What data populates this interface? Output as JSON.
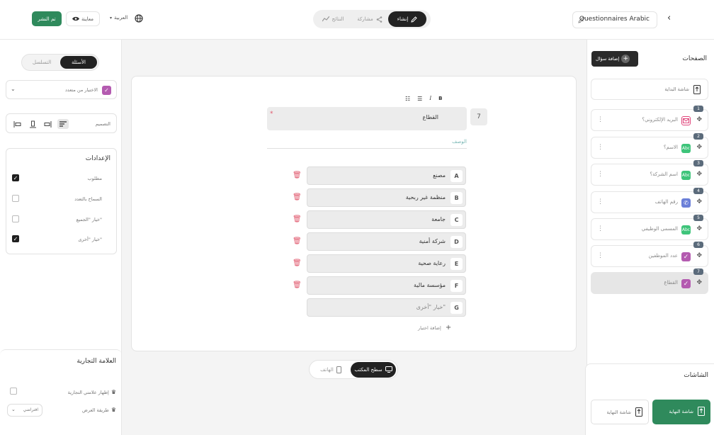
{
  "topbar": {
    "title": "Questionnaires Arabic",
    "tabs": [
      {
        "label": "إنشاء",
        "active": true
      },
      {
        "label": "مشاركة",
        "active": false
      },
      {
        "label": "النتائج",
        "active": false
      }
    ],
    "language": "العربية",
    "preview_label": "معاينة",
    "publish_label": "تم النشر"
  },
  "left_panel": {
    "tabs": [
      {
        "label": "الأسئلة",
        "active": true
      },
      {
        "label": "التسلسل",
        "active": false
      }
    ],
    "question_type": "الاختيار من متعدد",
    "design_label": "التصميم",
    "settings": {
      "title": "الإعدادات",
      "items": [
        {
          "label": "مطلوب",
          "checked": true
        },
        {
          "label": "السماح بالتعدد",
          "checked": false
        },
        {
          "label": "خيار \"الجميع\"",
          "checked": false
        },
        {
          "label": "خيار \"أخرى\"",
          "checked": true
        }
      ]
    },
    "branding": {
      "title": "العلامة التجارية",
      "show_brand_label": "إظهار علامتي التجارية",
      "show_brand_checked": false,
      "display_mode_label": "طريقة العرض",
      "display_mode_value": "افتراضي"
    }
  },
  "editor": {
    "question_number": "7",
    "question_title": "القطاع",
    "required_mark": "*",
    "description_placeholder": "الوصف",
    "toolbar": [
      "B",
      "I",
      "list",
      "numbered-list"
    ],
    "options": [
      {
        "letter": "A",
        "text": "مصنع"
      },
      {
        "letter": "B",
        "text": "منظمة غير ربحية"
      },
      {
        "letter": "C",
        "text": "جامعة"
      },
      {
        "letter": "D",
        "text": "شركة أمنية"
      },
      {
        "letter": "E",
        "text": "رعاية صحية"
      },
      {
        "letter": "F",
        "text": "مؤسسة مالية"
      },
      {
        "letter": "G",
        "text": "خيار \"أخرى\""
      }
    ],
    "add_option_label": "إضافة اختيار"
  },
  "view_toggle": {
    "desktop_label": "سطح المكتب",
    "mobile_label": "الهاتف"
  },
  "right_panel": {
    "pages_title": "الصفحات",
    "add_question_label": "إضافة سؤال",
    "start_page_label": "شاشة البداية",
    "questions": [
      {
        "num": "1",
        "label": "البريد الإلكتروني؟",
        "icon": "envelope-icon",
        "color": "#e0447a"
      },
      {
        "num": "2",
        "label": "الاسم؟",
        "icon": "text-abc-icon",
        "color": "#3ec47a"
      },
      {
        "num": "3",
        "label": "اسم الشركة؟",
        "icon": "text-abc-icon",
        "color": "#3ec47a"
      },
      {
        "num": "4",
        "label": "رقم الهاتف",
        "icon": "phone-icon",
        "color": "#6b7fd8"
      },
      {
        "num": "5",
        "label": "المسمى الوظيفي",
        "icon": "text-abc-icon",
        "color": "#3ec47a"
      },
      {
        "num": "6",
        "label": "عدد الموظفين",
        "icon": "check-icon",
        "color": "#b45bb0"
      },
      {
        "num": "7",
        "label": "القطاع",
        "icon": "check-icon",
        "color": "#b45bb0"
      }
    ],
    "screens_title": "الشاشات",
    "end_screen_label": "شاشة النهاية",
    "add_page_label": "شاشة النهاية"
  },
  "colors": {
    "accent_green": "#2f8a5c",
    "dark": "#1f1f1f",
    "danger": "#e0566b"
  }
}
